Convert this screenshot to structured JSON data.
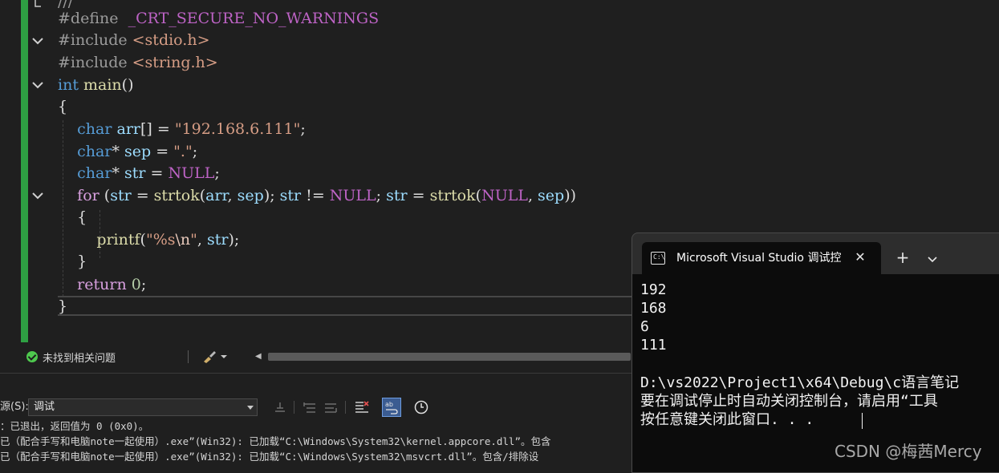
{
  "editor": {
    "lines": [
      {
        "parts": [
          {
            "t": "///",
            "c": "pp"
          }
        ]
      },
      {
        "parts": [
          {
            "t": "#define  ",
            "c": "pp"
          },
          {
            "t": "_CRT_SECURE_NO_WARNINGS",
            "c": "mac"
          }
        ]
      },
      {
        "parts": [
          {
            "t": "#include ",
            "c": "pp"
          },
          {
            "t": "<stdio.h>",
            "c": "str"
          }
        ]
      },
      {
        "parts": [
          {
            "t": "#include ",
            "c": "pp"
          },
          {
            "t": "<string.h>",
            "c": "str"
          }
        ]
      },
      {
        "parts": [
          {
            "t": "int ",
            "c": "kw"
          },
          {
            "t": "main",
            "c": "fn"
          },
          {
            "t": "()",
            "c": "punct"
          }
        ]
      },
      {
        "parts": [
          {
            "t": "{",
            "c": "punct"
          }
        ]
      },
      {
        "parts": [
          {
            "t": "    char ",
            "c": "kw"
          },
          {
            "t": "arr",
            "c": "var"
          },
          {
            "t": "[] = ",
            "c": "punct"
          },
          {
            "t": "\"192.168.6.111\"",
            "c": "str"
          },
          {
            "t": ";",
            "c": "punct"
          }
        ]
      },
      {
        "parts": [
          {
            "t": "    char",
            "c": "kw"
          },
          {
            "t": "* ",
            "c": "punct"
          },
          {
            "t": "sep",
            "c": "var"
          },
          {
            "t": " = ",
            "c": "punct"
          },
          {
            "t": "\".\"",
            "c": "str"
          },
          {
            "t": ";",
            "c": "punct"
          }
        ]
      },
      {
        "parts": [
          {
            "t": "    char",
            "c": "kw"
          },
          {
            "t": "* ",
            "c": "punct"
          },
          {
            "t": "str",
            "c": "var"
          },
          {
            "t": " = ",
            "c": "punct"
          },
          {
            "t": "NULL",
            "c": "mac"
          },
          {
            "t": ";",
            "c": "punct"
          }
        ]
      },
      {
        "parts": [
          {
            "t": "    for ",
            "c": "ctl"
          },
          {
            "t": "(",
            "c": "punct"
          },
          {
            "t": "str",
            "c": "var"
          },
          {
            "t": " = ",
            "c": "punct"
          },
          {
            "t": "strtok",
            "c": "fn"
          },
          {
            "t": "(",
            "c": "punct"
          },
          {
            "t": "arr",
            "c": "var"
          },
          {
            "t": ", ",
            "c": "punct"
          },
          {
            "t": "sep",
            "c": "var"
          },
          {
            "t": "); ",
            "c": "punct"
          },
          {
            "t": "str",
            "c": "var"
          },
          {
            "t": " != ",
            "c": "punct"
          },
          {
            "t": "NULL",
            "c": "mac"
          },
          {
            "t": "; ",
            "c": "punct"
          },
          {
            "t": "str",
            "c": "var"
          },
          {
            "t": " = ",
            "c": "punct"
          },
          {
            "t": "strtok",
            "c": "fn"
          },
          {
            "t": "(",
            "c": "punct"
          },
          {
            "t": "NULL",
            "c": "mac"
          },
          {
            "t": ", ",
            "c": "punct"
          },
          {
            "t": "sep",
            "c": "var"
          },
          {
            "t": "))",
            "c": "punct"
          }
        ]
      },
      {
        "parts": [
          {
            "t": "    {",
            "c": "punct"
          }
        ]
      },
      {
        "parts": [
          {
            "t": "        printf",
            "c": "fn"
          },
          {
            "t": "(",
            "c": "punct"
          },
          {
            "t": "\"%s",
            "c": "str"
          },
          {
            "t": "\\n",
            "c": "esc"
          },
          {
            "t": "\"",
            "c": "str"
          },
          {
            "t": ", ",
            "c": "punct"
          },
          {
            "t": "str",
            "c": "var"
          },
          {
            "t": ");",
            "c": "punct"
          }
        ]
      },
      {
        "parts": [
          {
            "t": "    }",
            "c": "punct"
          }
        ]
      },
      {
        "parts": [
          {
            "t": "    return ",
            "c": "ctl"
          },
          {
            "t": "0",
            "c": "num"
          },
          {
            "t": ";",
            "c": "punct"
          }
        ]
      },
      {
        "parts": [
          {
            "t": "}",
            "c": "punct"
          }
        ]
      }
    ]
  },
  "status": {
    "issues_text": "未找到相关问题",
    "brush_icon": "brush-icon"
  },
  "output": {
    "source_label": "源(S):",
    "source_value": "调试",
    "lines": [
      "：已退出，返回值为 0 (0x0)。",
      "已（配合手写和电脑note一起使用）.exe”(Win32): 已加载“C:\\Windows\\System32\\kernel.appcore.dll”。包含",
      "已（配合手写和电脑note一起使用）.exe”(Win32): 已加载“C:\\Windows\\System32\\msvcrt.dll”。包含/排除设"
    ]
  },
  "terminal": {
    "icon_text": "C:\\",
    "tab_title": "Microsoft Visual Studio 调试控制台",
    "lines": [
      "192",
      "168",
      "6",
      "111",
      "",
      "D:\\vs2022\\Project1\\x64\\Debug\\c语言笔记",
      "要在调试停止时自动关闭控制台，请启用“工具",
      "按任意键关闭此窗口. . ."
    ],
    "watermark": "CSDN @梅茜Mercy"
  },
  "colors": {
    "change_bar": "#2ea043",
    "keyword": "#569cd6",
    "string": "#d69d85",
    "function": "#dcdcaa",
    "variable": "#9cdcfe",
    "macro": "#bd63c5"
  }
}
